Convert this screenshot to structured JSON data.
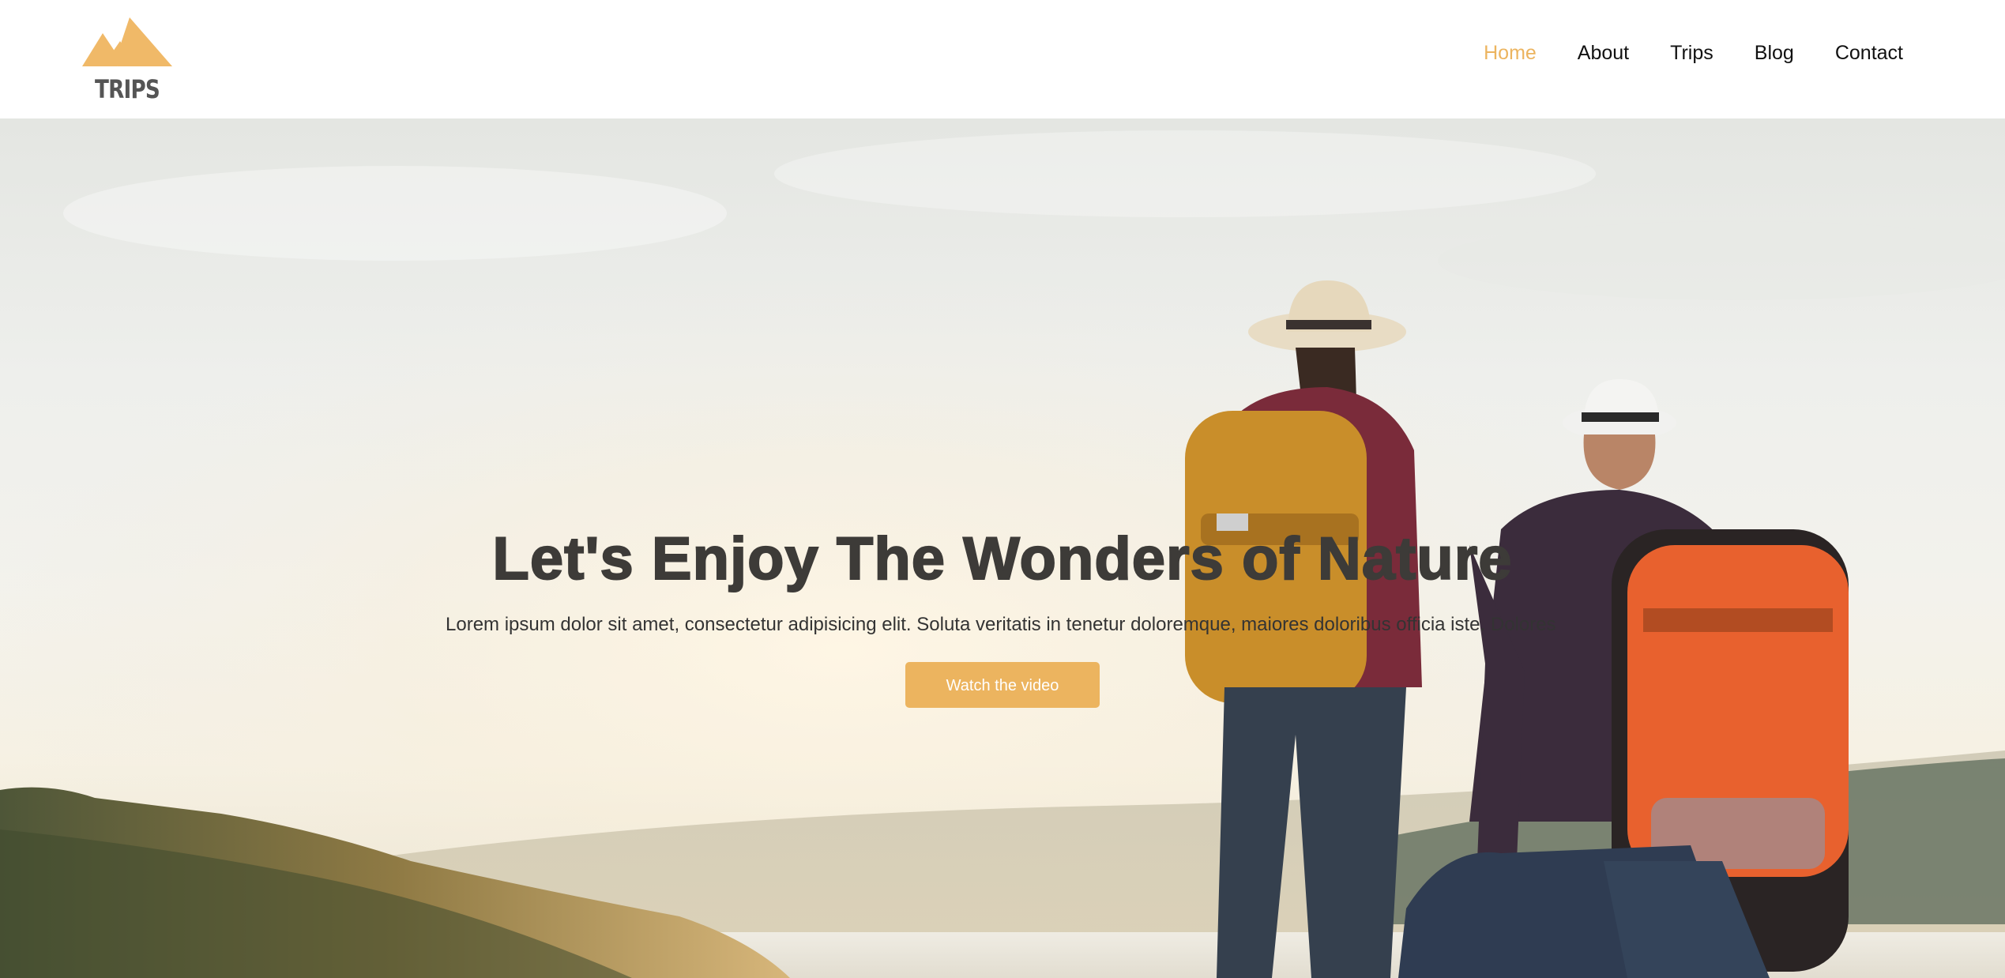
{
  "brand": {
    "name": "TRIPS",
    "logo_icon": "mountain-icon",
    "accent_color": "#ecb45f"
  },
  "nav": {
    "items": [
      {
        "label": "Home",
        "active": true
      },
      {
        "label": "About",
        "active": false
      },
      {
        "label": "Trips",
        "active": false
      },
      {
        "label": "Blog",
        "active": false
      },
      {
        "label": "Contact",
        "active": false
      }
    ]
  },
  "hero": {
    "title": "Let's Enjoy The Wonders of Nature",
    "text": "Lorem ipsum dolor sit amet, consectetur adipisicing elit. Soluta veritatis in tenetur doloremque, maiores doloribus officia iste. Dolores",
    "button_label": "Watch the video"
  }
}
